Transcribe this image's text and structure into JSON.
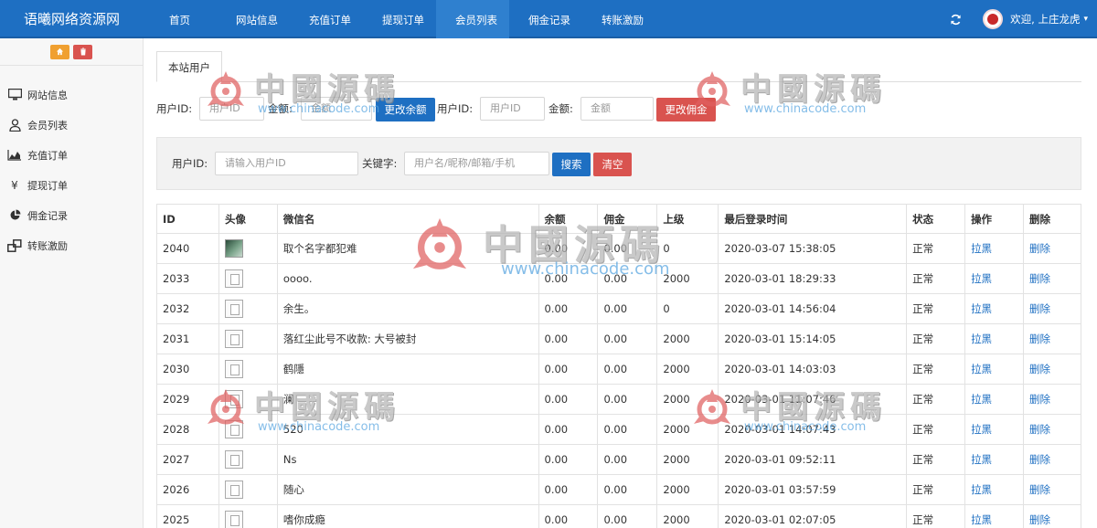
{
  "app": {
    "brand": "语曦网络资源网"
  },
  "nav": [
    {
      "label": "首页",
      "active": false
    },
    {
      "label": "网站信息",
      "active": false
    },
    {
      "label": "充值订单",
      "active": false
    },
    {
      "label": "提现订单",
      "active": false
    },
    {
      "label": "会员列表",
      "active": true
    },
    {
      "label": "佣金记录",
      "active": false
    },
    {
      "label": "转账激励",
      "active": false
    }
  ],
  "user": {
    "welcome": "欢迎, 上庄龙虎",
    "caret": "▾"
  },
  "sidebar": {
    "items": [
      {
        "label": "网站信息",
        "icon": "monitor-icon"
      },
      {
        "label": "会员列表",
        "icon": "user-icon"
      },
      {
        "label": "充值订单",
        "icon": "area-chart-icon"
      },
      {
        "label": "提现订单",
        "icon": "yen-icon"
      },
      {
        "label": "佣金记录",
        "icon": "pie-chart-icon"
      },
      {
        "label": "转账激励",
        "icon": "transfer-icon"
      }
    ]
  },
  "tab": {
    "label": "本站用户"
  },
  "balance_form": {
    "user_id_label": "用户ID:",
    "user_id_placeholder": "用户ID",
    "amount_label": "金额:",
    "amount_placeholder": "金额",
    "button": "更改余额"
  },
  "commission_form": {
    "user_id_label": "用户ID:",
    "user_id_placeholder": "用户ID",
    "amount_label": "金额:",
    "amount_placeholder": "金额",
    "button": "更改佣金"
  },
  "search": {
    "user_id_label": "用户ID:",
    "user_id_placeholder": "请输入用户ID",
    "keyword_label": "关键字:",
    "keyword_placeholder": "用户名/昵称/邮箱/手机",
    "search_button": "搜索",
    "clear_button": "清空"
  },
  "table": {
    "headers": [
      "ID",
      "头像",
      "微信名",
      "余额",
      "佣金",
      "上级",
      "最后登录时间",
      "状态",
      "操作",
      "删除"
    ],
    "rows": [
      {
        "id": "2040",
        "avatar": "photo",
        "name": "取个名字都犯难",
        "balance": "0.00",
        "commission": "0.00",
        "parent": "0",
        "last_login": "2020-03-07 15:38:05",
        "status": "正常",
        "action": "拉黑",
        "delete": "删除"
      },
      {
        "id": "2033",
        "avatar": "broken",
        "name": "oooo.",
        "balance": "0.00",
        "commission": "0.00",
        "parent": "2000",
        "last_login": "2020-03-01 18:29:33",
        "status": "正常",
        "action": "拉黑",
        "delete": "删除"
      },
      {
        "id": "2032",
        "avatar": "broken",
        "name": "余生。",
        "balance": "0.00",
        "commission": "0.00",
        "parent": "0",
        "last_login": "2020-03-01 14:56:04",
        "status": "正常",
        "action": "拉黑",
        "delete": "删除"
      },
      {
        "id": "2031",
        "avatar": "broken",
        "name": "落红尘此号不收款: 大号被封",
        "balance": "0.00",
        "commission": "0.00",
        "parent": "2000",
        "last_login": "2020-03-01 15:14:05",
        "status": "正常",
        "action": "拉黑",
        "delete": "删除"
      },
      {
        "id": "2030",
        "avatar": "broken",
        "name": "鹤隱",
        "balance": "0.00",
        "commission": "0.00",
        "parent": "2000",
        "last_login": "2020-03-01 14:03:03",
        "status": "正常",
        "action": "拉黑",
        "delete": "删除"
      },
      {
        "id": "2029",
        "avatar": "broken",
        "name": "澜",
        "balance": "0.00",
        "commission": "0.00",
        "parent": "2000",
        "last_login": "2020-03-01 11:07:46",
        "status": "正常",
        "action": "拉黑",
        "delete": "删除"
      },
      {
        "id": "2028",
        "avatar": "broken",
        "name": "520",
        "balance": "0.00",
        "commission": "0.00",
        "parent": "2000",
        "last_login": "2020-03-01 14:07:43",
        "status": "正常",
        "action": "拉黑",
        "delete": "删除"
      },
      {
        "id": "2027",
        "avatar": "broken",
        "name": "Ns",
        "balance": "0.00",
        "commission": "0.00",
        "parent": "2000",
        "last_login": "2020-03-01 09:52:11",
        "status": "正常",
        "action": "拉黑",
        "delete": "删除"
      },
      {
        "id": "2026",
        "avatar": "broken",
        "name": "随心",
        "balance": "0.00",
        "commission": "0.00",
        "parent": "2000",
        "last_login": "2020-03-01 03:57:59",
        "status": "正常",
        "action": "拉黑",
        "delete": "删除"
      },
      {
        "id": "2025",
        "avatar": "broken",
        "name": "嗜你成瘾",
        "balance": "0.00",
        "commission": "0.00",
        "parent": "2000",
        "last_login": "2020-03-01 02:07:05",
        "status": "正常",
        "action": "拉黑",
        "delete": "删除"
      }
    ]
  },
  "watermark": {
    "text": "中國源碼",
    "url": "www.chinacode.com"
  },
  "colors": {
    "primary": "#1e6fc2",
    "danger": "#d9534f",
    "warning": "#f0a030",
    "link": "#1e6fc2"
  }
}
